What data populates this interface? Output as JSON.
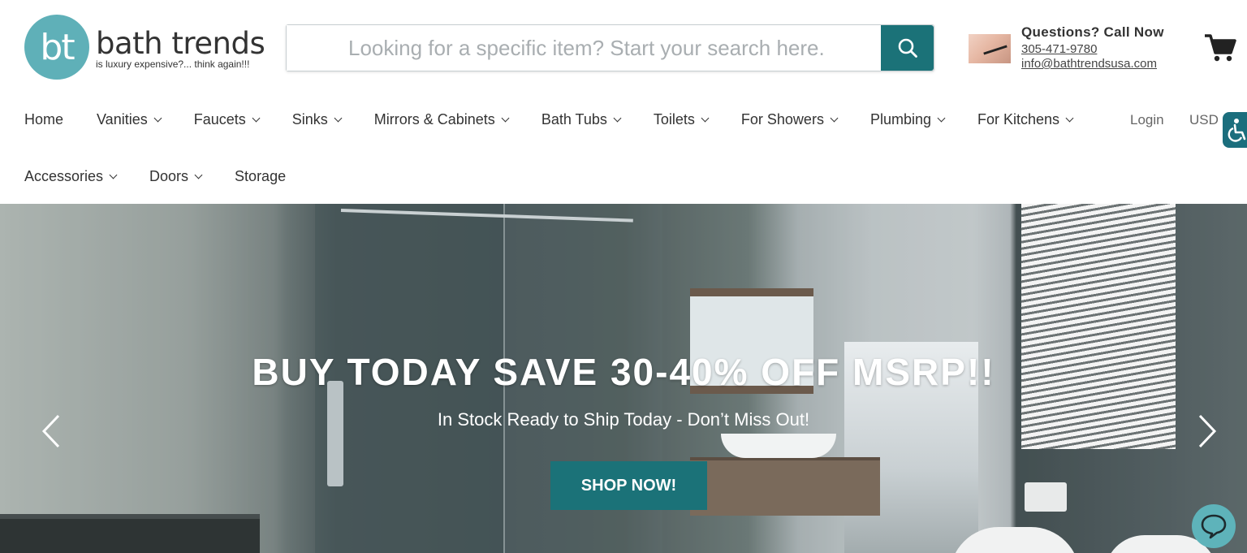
{
  "brand": {
    "logo_mark": "bt",
    "name": "bath trends",
    "tagline": "is luxury expensive?... think again!!!"
  },
  "search": {
    "placeholder": "Looking for a specific item? Start your search here."
  },
  "contact": {
    "title": "Questions? Call Now",
    "phone": "305-471-9780",
    "email": "info@bathtrendsusa.com"
  },
  "nav": {
    "row1": [
      {
        "label": "Home",
        "dropdown": false
      },
      {
        "label": "Vanities",
        "dropdown": true
      },
      {
        "label": "Faucets",
        "dropdown": true
      },
      {
        "label": "Sinks",
        "dropdown": true
      },
      {
        "label": "Mirrors & Cabinets",
        "dropdown": true
      },
      {
        "label": "Bath Tubs",
        "dropdown": true
      },
      {
        "label": "Toilets",
        "dropdown": true
      },
      {
        "label": "For Showers",
        "dropdown": true
      },
      {
        "label": "Plumbing",
        "dropdown": true
      },
      {
        "label": "For Kitchens",
        "dropdown": true
      }
    ],
    "row2": [
      {
        "label": "Accessories",
        "dropdown": true
      },
      {
        "label": "Doors",
        "dropdown": true
      },
      {
        "label": "Storage",
        "dropdown": false
      }
    ]
  },
  "utility": {
    "login": "Login",
    "currency": "USD"
  },
  "hero": {
    "title": "BUY TODAY SAVE 30-40% OFF MSRP!!",
    "subtitle": "In Stock Ready to Ship Today - Don’t Miss Out!",
    "cta": "SHOP NOW!"
  },
  "icons": {
    "search": "search-icon",
    "cart": "cart-icon",
    "accessibility": "accessibility-icon",
    "prev": "chevron-left-icon",
    "next": "chevron-right-icon",
    "chat": "chat-icon"
  },
  "colors": {
    "brand_teal": "#1b7278",
    "logo_teal": "#5fb0b8",
    "chat_teal": "#5eb3ba",
    "access_blue": "#1b6e7d"
  }
}
